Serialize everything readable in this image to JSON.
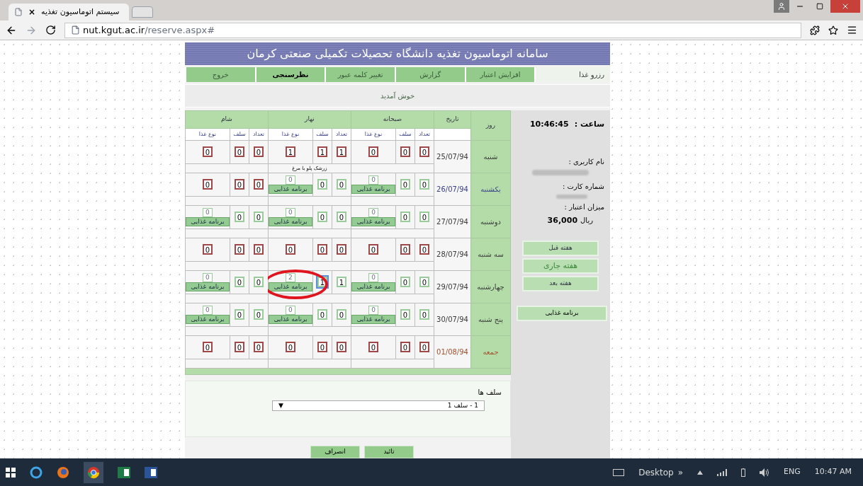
{
  "browser": {
    "tab_title": "سیستم اتوماسیون تغذیه",
    "tab_close": "×",
    "url_host": "nut.kgut.ac.ir",
    "url_path": "/reserve.aspx#"
  },
  "header": {
    "title": "سامانه اتوماسیون تغذیه دانشگاه تحصیلات تکمیلی صنعتی کرمان"
  },
  "menu": [
    {
      "label": "رزرو غذا",
      "selected": true,
      "bold": false
    },
    {
      "label": "افزایش اعتبار",
      "selected": false,
      "bold": false
    },
    {
      "label": "گزارش",
      "selected": false,
      "bold": false
    },
    {
      "label": "تغییر کلمه عبور",
      "selected": false,
      "bold": false
    },
    {
      "label": "نظرسنجی",
      "selected": false,
      "bold": true
    },
    {
      "label": "خروج",
      "selected": false,
      "bold": false
    }
  ],
  "welcome": "خوش آمدید",
  "table": {
    "day_header": "روز",
    "date_header": "تاریخ",
    "meals": [
      {
        "name": "صبحانه",
        "fields": [
          "تعداد",
          "سلف",
          "نوع غذا"
        ]
      },
      {
        "name": "نهار",
        "fields": [
          "تعداد",
          "سلف",
          "نوع غذا"
        ]
      },
      {
        "name": "شام",
        "fields": [
          "تعداد",
          "سلف",
          "نوع غذا"
        ]
      }
    ],
    "rows": [
      {
        "day": "شنبه",
        "date": "25/07/94",
        "color": "#3a3a3a",
        "meals": [
          {
            "cells": [
              {
                "kind": "box",
                "value": "0",
                "locked": true,
                "focused": false,
                "circled": false
              },
              {
                "kind": "box",
                "value": "0",
                "locked": true,
                "focused": false,
                "circled": false
              },
              {
                "kind": "box",
                "value": "0",
                "locked": true,
                "focused": false,
                "circled": false
              }
            ]
          },
          {
            "note": "زرشک پلو با مرغ",
            "cells": [
              {
                "kind": "box",
                "value": "1",
                "locked": true,
                "focused": false,
                "circled": false
              },
              {
                "kind": "box",
                "value": "1",
                "locked": true,
                "focused": false,
                "circled": false
              },
              {
                "kind": "box",
                "value": "1",
                "locked": true,
                "focused": false,
                "circled": false
              }
            ]
          },
          {
            "cells": [
              {
                "kind": "box",
                "value": "0",
                "locked": true,
                "focused": false,
                "circled": false
              },
              {
                "kind": "box",
                "value": "0",
                "locked": true,
                "focused": false,
                "circled": false
              },
              {
                "kind": "box",
                "value": "0",
                "locked": true,
                "focused": false,
                "circled": false
              }
            ]
          }
        ]
      },
      {
        "day": "یکشنبه",
        "date": "26/07/94",
        "color": "#3a3f8a",
        "meals": [
          {
            "cells": [
              {
                "kind": "box",
                "value": "0",
                "locked": false,
                "focused": false,
                "circled": false
              },
              {
                "kind": "box",
                "value": "0",
                "locked": false,
                "focused": false,
                "circled": false
              },
              {
                "kind": "menu",
                "value": "0",
                "label": "برنامه غذایی",
                "locked": false,
                "focused": false,
                "circled": false
              }
            ]
          },
          {
            "cells": [
              {
                "kind": "box",
                "value": "0",
                "locked": false,
                "focused": false,
                "circled": false
              },
              {
                "kind": "box",
                "value": "0",
                "locked": false,
                "focused": false,
                "circled": false
              },
              {
                "kind": "menu",
                "value": "0",
                "label": "برنامه غذایی",
                "locked": false,
                "focused": false,
                "circled": false
              }
            ]
          },
          {
            "cells": [
              {
                "kind": "box",
                "value": "0",
                "locked": true,
                "focused": false,
                "circled": false
              },
              {
                "kind": "box",
                "value": "0",
                "locked": true,
                "focused": false,
                "circled": false
              },
              {
                "kind": "box",
                "value": "0",
                "locked": true,
                "focused": false,
                "circled": false
              }
            ]
          }
        ]
      },
      {
        "day": "دوشنبه",
        "date": "27/07/94",
        "color": "#3a3a3a",
        "meals": [
          {
            "cells": [
              {
                "kind": "box",
                "value": "0",
                "locked": false,
                "focused": false,
                "circled": false
              },
              {
                "kind": "box",
                "value": "0",
                "locked": false,
                "focused": false,
                "circled": false
              },
              {
                "kind": "menu",
                "value": "0",
                "label": "برنامه غذایی",
                "locked": false,
                "focused": false,
                "circled": false
              }
            ]
          },
          {
            "cells": [
              {
                "kind": "box",
                "value": "0",
                "locked": false,
                "focused": false,
                "circled": false
              },
              {
                "kind": "box",
                "value": "0",
                "locked": false,
                "focused": false,
                "circled": false
              },
              {
                "kind": "menu",
                "value": "0",
                "label": "برنامه غذایی",
                "locked": false,
                "focused": false,
                "circled": false
              }
            ]
          },
          {
            "cells": [
              {
                "kind": "box",
                "value": "0",
                "locked": false,
                "focused": false,
                "circled": false
              },
              {
                "kind": "box",
                "value": "0",
                "locked": false,
                "focused": false,
                "circled": false
              },
              {
                "kind": "menu",
                "value": "0",
                "label": "برنامه غذایی",
                "locked": false,
                "focused": false,
                "circled": false
              }
            ]
          }
        ]
      },
      {
        "day": "سه شنبه",
        "date": "28/07/94",
        "color": "#3a3a3a",
        "meals": [
          {
            "cells": [
              {
                "kind": "box",
                "value": "0",
                "locked": true,
                "focused": false,
                "circled": false
              },
              {
                "kind": "box",
                "value": "0",
                "locked": true,
                "focused": false,
                "circled": false
              },
              {
                "kind": "box",
                "value": "0",
                "locked": true,
                "focused": false,
                "circled": false
              }
            ]
          },
          {
            "cells": [
              {
                "kind": "box",
                "value": "0",
                "locked": true,
                "focused": false,
                "circled": false
              },
              {
                "kind": "box",
                "value": "0",
                "locked": true,
                "focused": false,
                "circled": false
              },
              {
                "kind": "box",
                "value": "0",
                "locked": true,
                "focused": false,
                "circled": false
              }
            ]
          },
          {
            "cells": [
              {
                "kind": "box",
                "value": "0",
                "locked": true,
                "focused": false,
                "circled": false
              },
              {
                "kind": "box",
                "value": "0",
                "locked": true,
                "focused": false,
                "circled": false
              },
              {
                "kind": "box",
                "value": "0",
                "locked": true,
                "focused": false,
                "circled": false
              }
            ]
          }
        ]
      },
      {
        "day": "چهارشنبه",
        "date": "29/07/94",
        "color": "#3a3a3a",
        "meals": [
          {
            "cells": [
              {
                "kind": "box",
                "value": "0",
                "locked": false,
                "focused": false,
                "circled": false
              },
              {
                "kind": "box",
                "value": "0",
                "locked": false,
                "focused": false,
                "circled": false
              },
              {
                "kind": "menu",
                "value": "0",
                "label": "برنامه غذایی",
                "locked": false,
                "focused": false,
                "circled": false
              }
            ]
          },
          {
            "cells": [
              {
                "kind": "box",
                "value": "1",
                "locked": false,
                "focused": false,
                "circled": false
              },
              {
                "kind": "box",
                "value": "1",
                "locked": false,
                "focused": true,
                "circled": false
              },
              {
                "kind": "menu",
                "value": "2",
                "label": "برنامه غذایی",
                "locked": false,
                "focused": false,
                "circled": true
              }
            ]
          },
          {
            "cells": [
              {
                "kind": "box",
                "value": "0",
                "locked": false,
                "focused": false,
                "circled": false
              },
              {
                "kind": "box",
                "value": "0",
                "locked": false,
                "focused": false,
                "circled": false
              },
              {
                "kind": "menu",
                "value": "0",
                "label": "برنامه غذایی",
                "locked": false,
                "focused": false,
                "circled": false
              }
            ]
          }
        ]
      },
      {
        "day": "پنج شنبه",
        "date": "30/07/94",
        "color": "#3a3a3a",
        "meals": [
          {
            "cells": [
              {
                "kind": "box",
                "value": "0",
                "locked": false,
                "focused": false,
                "circled": false
              },
              {
                "kind": "box",
                "value": "0",
                "locked": false,
                "focused": false,
                "circled": false
              },
              {
                "kind": "menu",
                "value": "0",
                "label": "برنامه غذایی",
                "locked": false,
                "focused": false,
                "circled": false
              }
            ]
          },
          {
            "cells": [
              {
                "kind": "box",
                "value": "0",
                "locked": false,
                "focused": false,
                "circled": false
              },
              {
                "kind": "box",
                "value": "0",
                "locked": false,
                "focused": false,
                "circled": false
              },
              {
                "kind": "menu",
                "value": "0",
                "label": "برنامه غذایی",
                "locked": false,
                "focused": false,
                "circled": false
              }
            ]
          },
          {
            "cells": [
              {
                "kind": "box",
                "value": "0",
                "locked": false,
                "focused": false,
                "circled": false
              },
              {
                "kind": "box",
                "value": "0",
                "locked": false,
                "focused": false,
                "circled": false
              },
              {
                "kind": "menu",
                "value": "0",
                "label": "برنامه غذایی",
                "locked": false,
                "focused": false,
                "circled": false
              }
            ]
          }
        ]
      },
      {
        "day": "جمعه",
        "date": "01/08/94",
        "color": "#a0522d",
        "meals": [
          {
            "cells": [
              {
                "kind": "box",
                "value": "0",
                "locked": true,
                "focused": false,
                "circled": false
              },
              {
                "kind": "box",
                "value": "0",
                "locked": true,
                "focused": false,
                "circled": false
              },
              {
                "kind": "box",
                "value": "0",
                "locked": true,
                "focused": false,
                "circled": false
              }
            ]
          },
          {
            "cells": [
              {
                "kind": "box",
                "value": "0",
                "locked": true,
                "focused": false,
                "circled": false
              },
              {
                "kind": "box",
                "value": "0",
                "locked": true,
                "focused": false,
                "circled": false
              },
              {
                "kind": "box",
                "value": "0",
                "locked": true,
                "focused": false,
                "circled": false
              }
            ]
          },
          {
            "cells": [
              {
                "kind": "box",
                "value": "0",
                "locked": true,
                "focused": false,
                "circled": false
              },
              {
                "kind": "box",
                "value": "0",
                "locked": true,
                "focused": false,
                "circled": false
              },
              {
                "kind": "box",
                "value": "0",
                "locked": true,
                "focused": false,
                "circled": false
              }
            ]
          }
        ]
      }
    ]
  },
  "salf": {
    "label": "سلف ها",
    "value": "1 - سلف 1",
    "arrow": "▼"
  },
  "actions": [
    "تائید",
    "انصراف"
  ],
  "sidebar": {
    "clock_label": "ساعت :",
    "clock": "10:46:45",
    "username_label": "نام کاربری :",
    "card_label": "شماره کارت :",
    "credit_label": "میزان اعتبار :",
    "credit_amount": "36,000",
    "credit_unit": "ریال",
    "weeks": [
      {
        "label": "هفته قبل",
        "selected": false
      },
      {
        "label": "هفته جاری",
        "selected": true
      },
      {
        "label": "هفته بعد",
        "selected": false
      }
    ],
    "menu_button": "برنامه غذایی"
  },
  "taskbar": {
    "desktop": "Desktop",
    "chevron": "»",
    "language": "ENG",
    "time": "10:47 AM"
  }
}
